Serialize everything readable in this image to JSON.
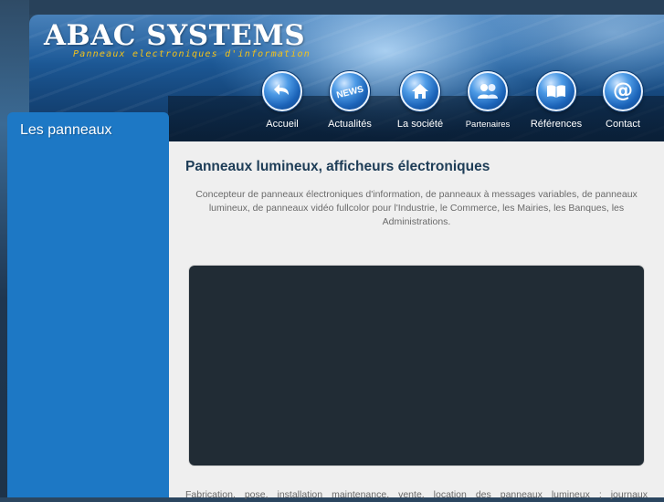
{
  "brand": {
    "title": "ABAC SYSTEMS",
    "subtitle": "Panneaux electroniques d'information"
  },
  "nav": {
    "items": [
      {
        "label": "Accueil",
        "icon": "back-arrow-icon"
      },
      {
        "label": "Actualités",
        "icon": "news-icon",
        "badge": "NEWS"
      },
      {
        "label": "La société",
        "icon": "home-icon"
      },
      {
        "label": "Partenaires",
        "icon": "users-icon"
      },
      {
        "label": "Références",
        "icon": "book-icon"
      },
      {
        "label": "Contact",
        "icon": "at-icon",
        "glyph": "@"
      }
    ]
  },
  "sidebar": {
    "title": "Les panneaux"
  },
  "main": {
    "title": "Panneaux lumineux, afficheurs électroniques",
    "intro": "Concepteur de panneaux électroniques d'information, de panneaux à messages variables, de panneaux lumineux, de panneaux vidéo fullcolor pour l'Industrie, le Commerce, les Mairies, les Banques, les Administrations.",
    "footer_partial": "Fabrication, pose, installation maintenance, vente, location des panneaux lumineux ; journaux"
  },
  "colors": {
    "accent_blue": "#1d78c5",
    "title_dark": "#1e3d57",
    "logo_yellow": "#f3c21a",
    "media_dark": "#212c35"
  }
}
